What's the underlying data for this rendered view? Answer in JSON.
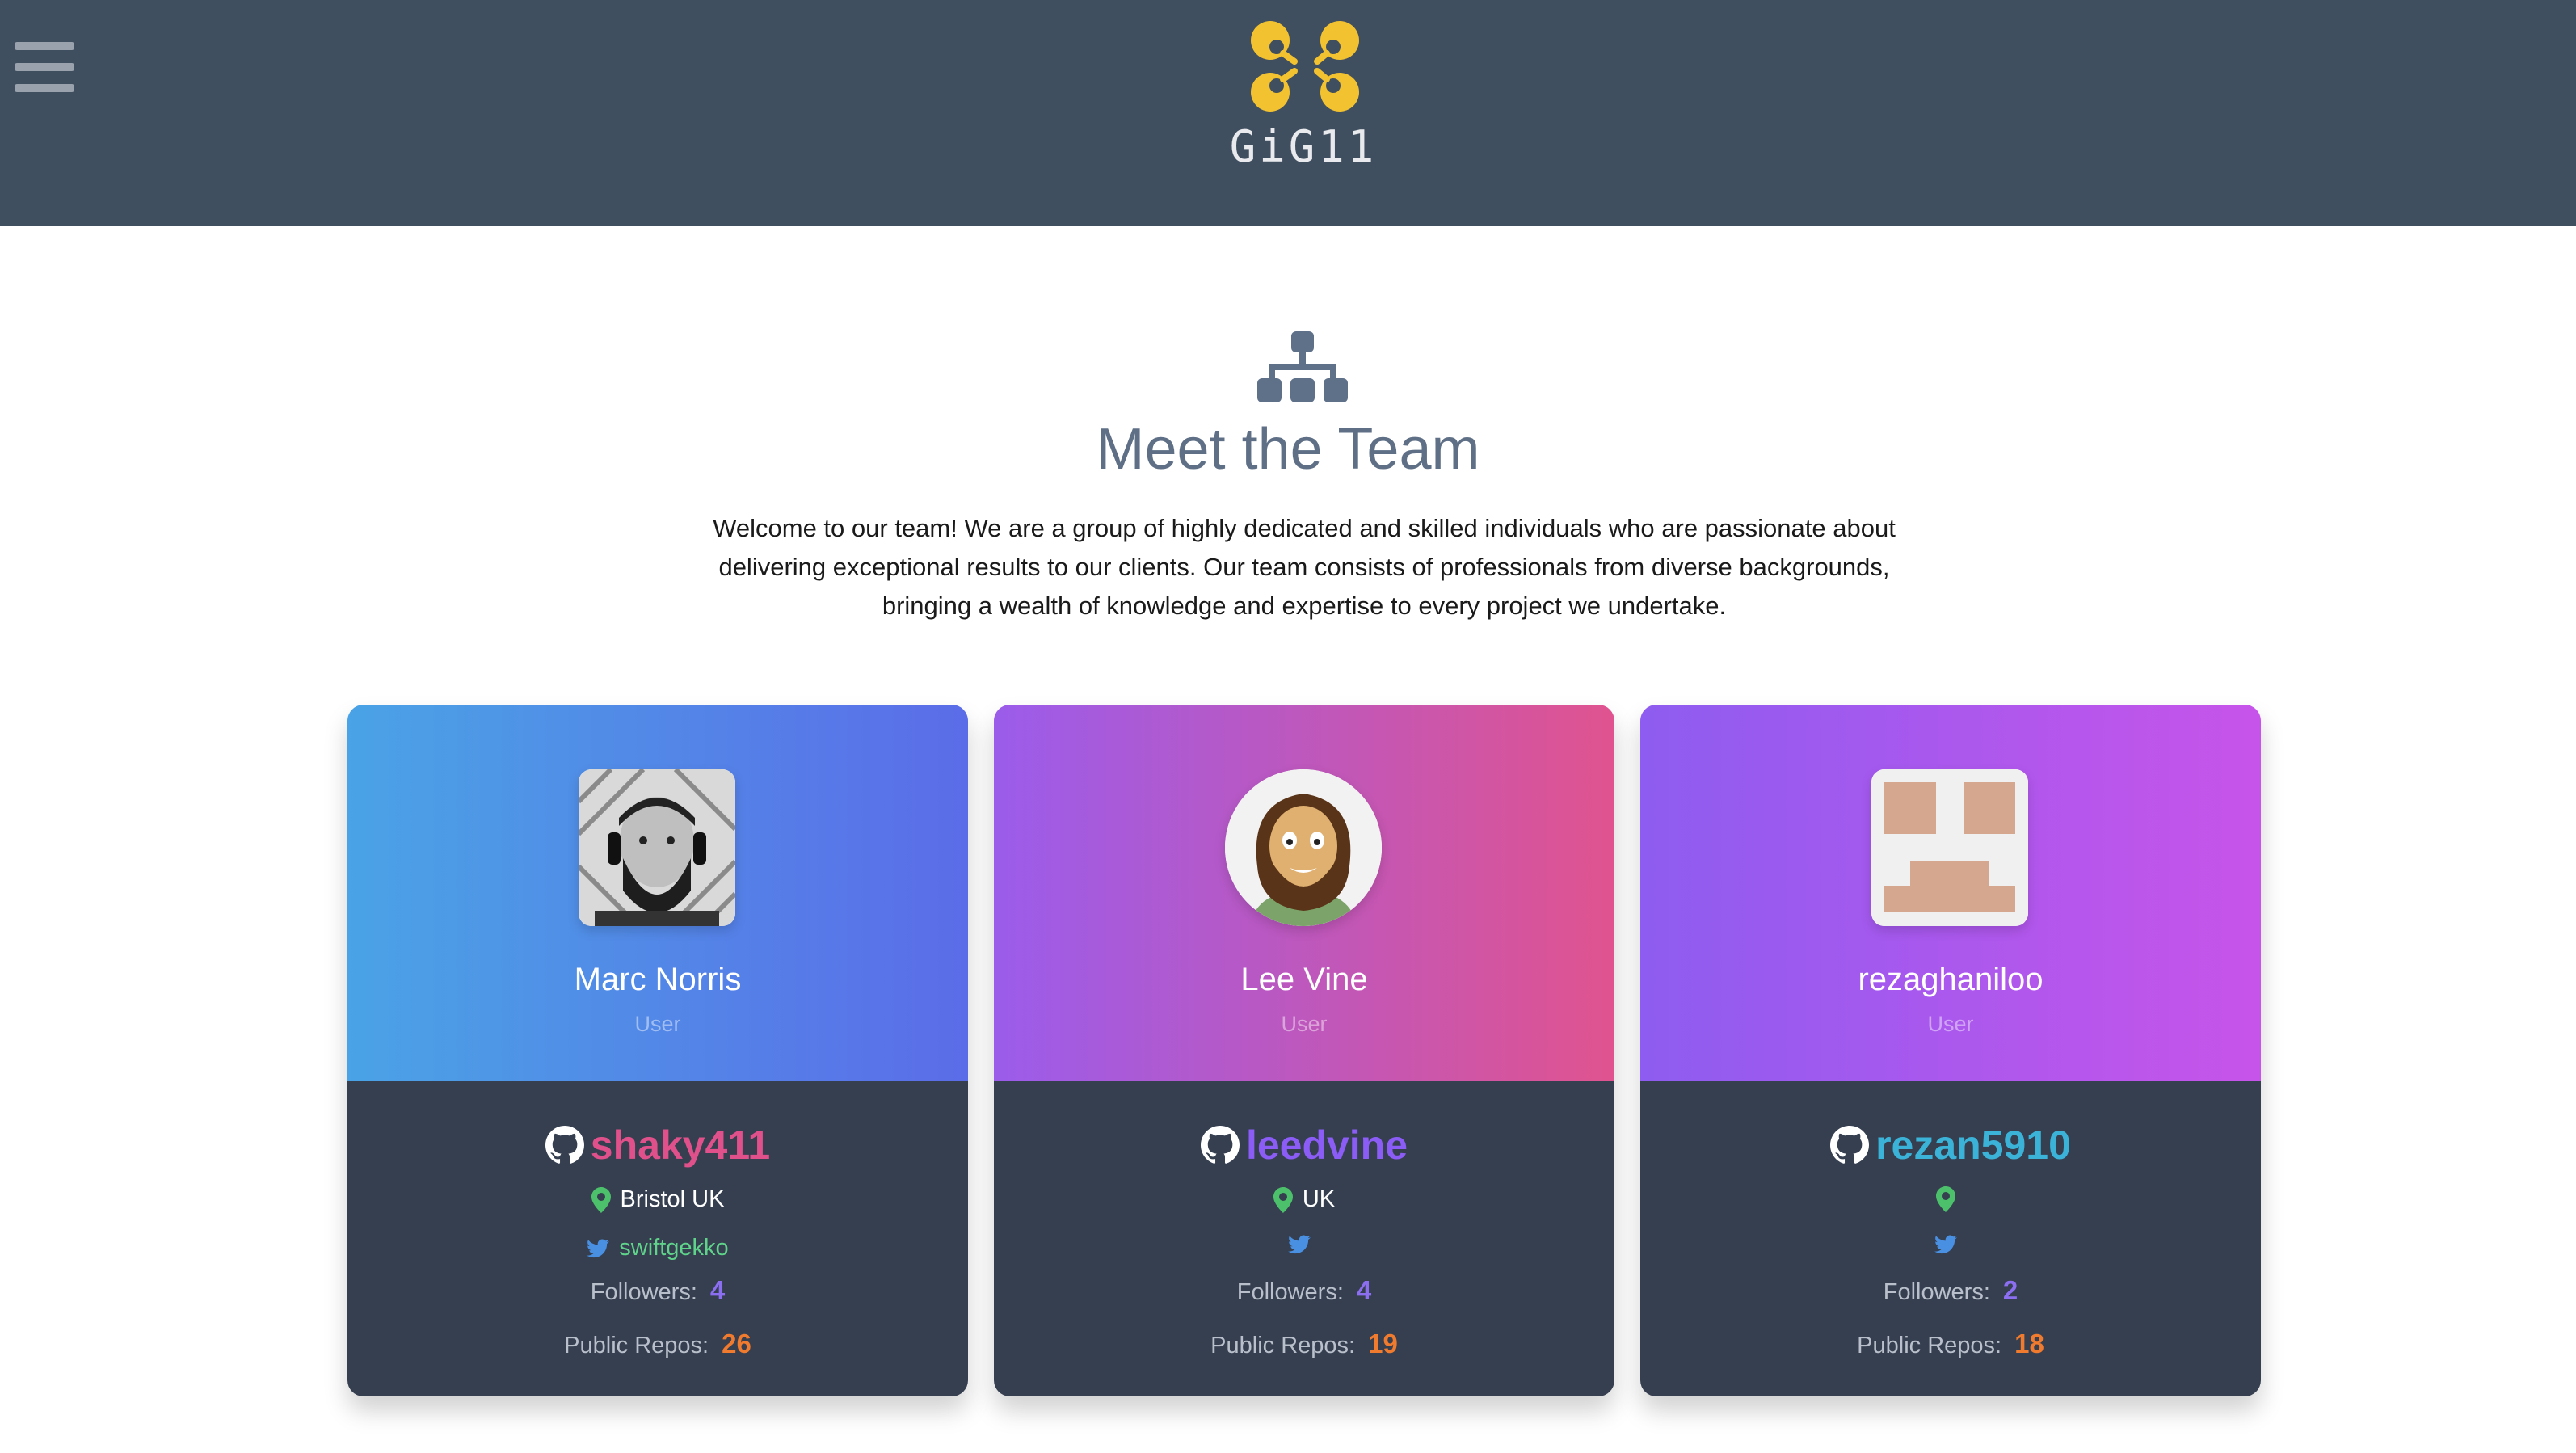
{
  "header": {
    "brand": "GiG11",
    "menu_icon": "hamburger-icon",
    "logo_icon": "gig11-logo-icon",
    "background": "#404f5f",
    "logo_color": "#f3c230"
  },
  "hero": {
    "icon": "sitemap-icon",
    "title": "Meet the Team",
    "intro_lines": [
      "Welcome to our team! We are a group of highly dedicated and skilled individuals who are passionate about",
      "delivering exceptional results to our clients. Our team consists of professionals from diverse backgrounds,",
      "bringing a wealth of knowledge and expertise to every project we undertake."
    ]
  },
  "labels": {
    "followers": "Followers:",
    "repos": "Public Repos:"
  },
  "members": [
    {
      "name": "Marc Norris",
      "role": "User",
      "github": "shaky411",
      "github_color": "#e0508a",
      "location": "Bristol UK",
      "twitter": "swiftgekko",
      "followers": "4",
      "repos": "26",
      "gradient": [
        "#4aa3e6",
        "#5b6ce8"
      ]
    },
    {
      "name": "Lee Vine",
      "role": "User",
      "github": "leedvine",
      "github_color": "#8b5cf6",
      "location": "UK",
      "twitter": "",
      "followers": "4",
      "repos": "19",
      "gradient": [
        "#9b5ceb",
        "#e0538f"
      ]
    },
    {
      "name": "rezaghaniloo",
      "role": "User",
      "github": "rezan5910",
      "github_color": "#3bb3d8",
      "location": "",
      "twitter": "",
      "followers": "2",
      "repos": "18",
      "gradient": [
        "#8e5cf0",
        "#c754ea"
      ]
    }
  ],
  "colors": {
    "location_pin": "#4cc06a",
    "twitter_bird": "#4a90e2",
    "followers_value": "#8b6ff0",
    "repos_value": "#f07a2e"
  }
}
